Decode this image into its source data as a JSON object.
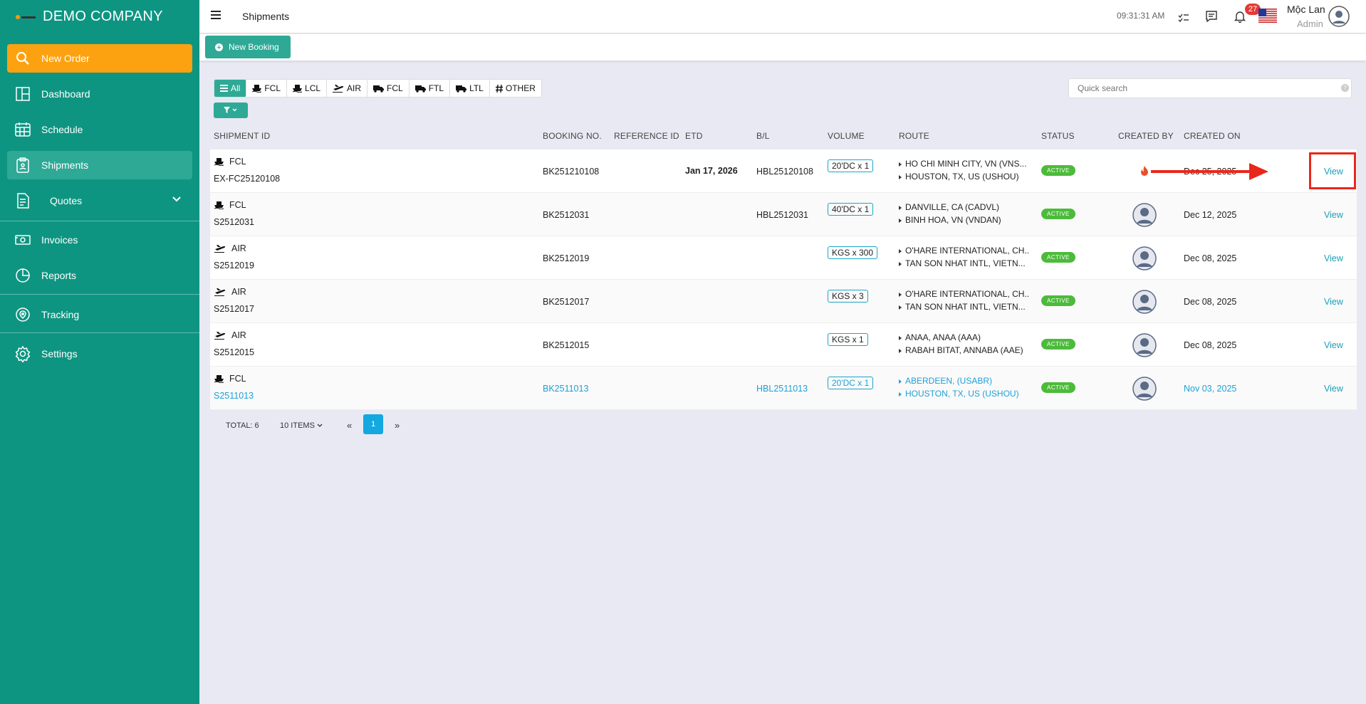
{
  "sidebar": {
    "brand": "DEMO COMPANY",
    "items": [
      {
        "label": "New Order",
        "icon": "search-icon"
      },
      {
        "label": "Dashboard",
        "icon": "dashboard-icon"
      },
      {
        "label": "Schedule",
        "icon": "calendar-icon"
      },
      {
        "label": "Shipments",
        "icon": "clipboard-icon"
      },
      {
        "label": "Quotes",
        "icon": "document-icon"
      },
      {
        "label": "Invoices",
        "icon": "invoice-icon"
      },
      {
        "label": "Reports",
        "icon": "pie-chart-icon"
      },
      {
        "label": "Tracking",
        "icon": "location-icon"
      },
      {
        "label": "Settings",
        "icon": "gear-icon"
      }
    ]
  },
  "topbar": {
    "title": "Shipments",
    "time": "09:31:31 AM",
    "notification_count": "27",
    "user_name": "Mộc Lan",
    "user_role": "Admin"
  },
  "actions": {
    "new_booking": "New Booking"
  },
  "tabs": [
    "All",
    "FCL",
    "LCL",
    "AIR",
    "FCL",
    "FTL",
    "LTL",
    "OTHER"
  ],
  "search": {
    "placeholder": "Quick search"
  },
  "columns": {
    "shipment_id": "SHIPMENT ID",
    "booking_no": "BOOKING NO.",
    "reference_id": "REFERENCE ID",
    "etd": "ETD",
    "bl": "B/L",
    "volume": "VOLUME",
    "route": "ROUTE",
    "status": "STATUS",
    "created_by": "CREATED BY",
    "created_on": "CREATED ON"
  },
  "rows": [
    {
      "mode": "FCL",
      "id": "EX-FC25120108",
      "booking": "BK251210108",
      "etd": "Jan 17, 2026",
      "bl": "HBL25120108",
      "volume": "20'DC x 1",
      "from": "HO CHI MINH CITY, VN (VNS...",
      "to": "HOUSTON, TX, US (USHOU)",
      "status": "ACTIVE",
      "created_on": "Dec 25, 2025",
      "view": "View"
    },
    {
      "mode": "FCL",
      "id": "S2512031",
      "booking": "BK2512031",
      "etd": "",
      "bl": "HBL2512031",
      "volume": "40'DC x 1",
      "from": "DANVILLE, CA (CADVL)",
      "to": "BINH HOA, VN (VNDAN)",
      "status": "ACTIVE",
      "created_on": "Dec 12, 2025",
      "view": "View"
    },
    {
      "mode": "AIR",
      "id": "S2512019",
      "booking": "BK2512019",
      "etd": "",
      "bl": "",
      "volume": "KGS x 300",
      "from": "O'HARE INTERNATIONAL, CH...",
      "to": "TAN SON NHAT INTL, VIETN...",
      "status": "ACTIVE",
      "created_on": "Dec 08, 2025",
      "view": "View"
    },
    {
      "mode": "AIR",
      "id": "S2512017",
      "booking": "BK2512017",
      "etd": "",
      "bl": "",
      "volume": "KGS x 3",
      "from": "O'HARE INTERNATIONAL, CH...",
      "to": "TAN SON NHAT INTL, VIETN...",
      "status": "ACTIVE",
      "created_on": "Dec 08, 2025",
      "view": "View"
    },
    {
      "mode": "AIR",
      "id": "S2512015",
      "booking": "BK2512015",
      "etd": "",
      "bl": "",
      "volume": "KGS x 1",
      "from": "ANAA, ANAA (AAA)",
      "to": "RABAH BITAT, ANNABA (AAE)",
      "status": "ACTIVE",
      "created_on": "Dec 08, 2025",
      "view": "View"
    },
    {
      "mode": "FCL",
      "id": "S2511013",
      "booking": "BK2511013",
      "etd": "",
      "bl": "HBL2511013",
      "volume": "20'DC x 1",
      "from": "ABERDEEN, (USABR)",
      "to": "HOUSTON, TX, US (USHOU)",
      "status": "ACTIVE",
      "created_on": "Nov 03, 2025",
      "view": "View"
    }
  ],
  "pagination": {
    "total": "TOTAL: 6",
    "per_page": "10 ITEMS",
    "prev": "«",
    "current": "1",
    "next": "»"
  },
  "colors": {
    "primary": "#0e9582",
    "accent": "#fca211",
    "status_active": "#4cbb3a",
    "link": "#1ea0d8",
    "annotation": "#e8281c"
  }
}
